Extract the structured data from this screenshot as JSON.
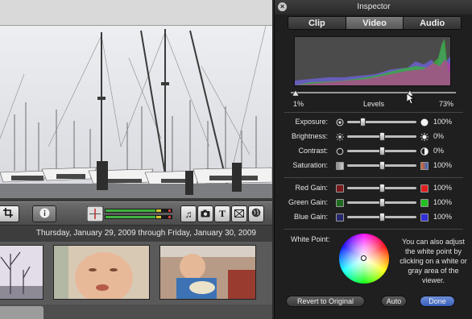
{
  "timeline": {
    "date_range": "Thursday, January 29, 2009 through Friday, January 30, 2009"
  },
  "inspector": {
    "title": "Inspector",
    "close_glyph": "×",
    "tabs": [
      {
        "label": "Clip",
        "active": false
      },
      {
        "label": "Video",
        "active": true
      },
      {
        "label": "Audio",
        "active": false
      }
    ],
    "levels": {
      "min": "1%",
      "label": "Levels",
      "max": "73%",
      "min_fraction": 0.01,
      "max_fraction": 0.73
    },
    "adjustments": [
      {
        "label": "Exposure:",
        "value": "100%",
        "level": 0.2,
        "left_icon": "exposure-low-icon",
        "right_icon": "exposure-high-icon"
      },
      {
        "label": "Brightness:",
        "value": "0%",
        "level": 0.5,
        "left_icon": "sun-small-icon",
        "right_icon": "sun-large-icon"
      },
      {
        "label": "Contrast:",
        "value": "0%",
        "level": 0.5,
        "left_icon": "contrast-low-icon",
        "right_icon": "contrast-high-icon"
      },
      {
        "label": "Saturation:",
        "value": "100%",
        "level": 0.5,
        "left_icon": "saturation-low-icon",
        "right_icon": "saturation-high-icon"
      }
    ],
    "gains": [
      {
        "label": "Red Gain:",
        "value": "100%",
        "level": 0.5,
        "color_dim": "#7a1a1a",
        "color": "#e02020"
      },
      {
        "label": "Green Gain:",
        "value": "100%",
        "level": 0.5,
        "color_dim": "#1f6a1f",
        "color": "#22c022"
      },
      {
        "label": "Blue Gain:",
        "value": "100%",
        "level": 0.5,
        "color_dim": "#27276e",
        "color": "#3030d8"
      }
    ],
    "white_point": {
      "label": "White Point:",
      "help": "You can also adjust the white point by clicking on a white or gray area of the viewer."
    },
    "buttons": {
      "revert": "Revert to Original",
      "auto": "Auto",
      "done": "Done"
    }
  },
  "colors": {
    "accent_blue": "#3a5fb8",
    "hud_bg": "#1f1f1f"
  }
}
